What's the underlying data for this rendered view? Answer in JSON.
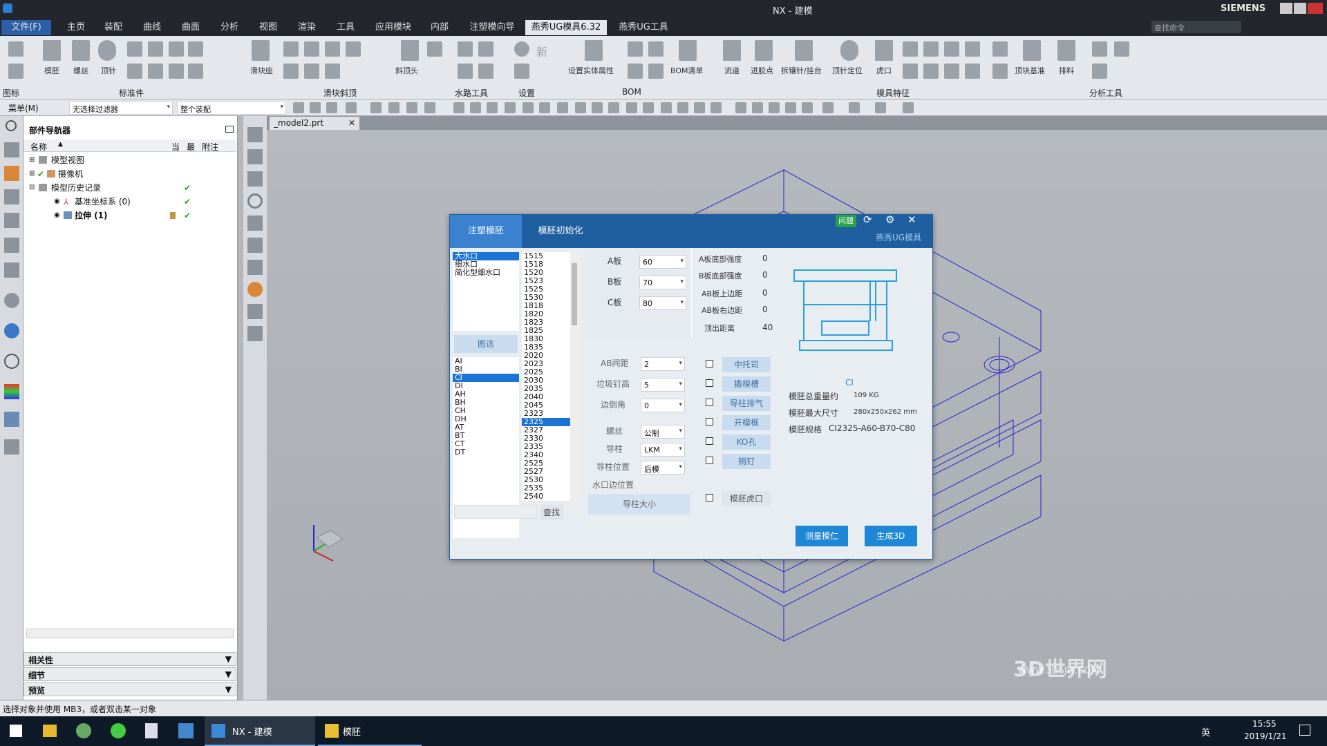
{
  "window": {
    "title": "NX - 建模",
    "brand": "SIEMENS",
    "search_placeholder": "查找命令"
  },
  "ribbon": {
    "tabs": [
      "文件(F)",
      "主页",
      "装配",
      "曲线",
      "曲面",
      "分析",
      "视图",
      "渲染",
      "工具",
      "应用模块",
      "内部",
      "注塑模向导",
      "燕秀UG模具6.32",
      "燕秀UG工具"
    ],
    "buttons": [
      "模胚",
      "螺丝",
      "顶针",
      "滑块座",
      "斜顶头",
      "设置实体属性",
      "BOM清单",
      "流道",
      "进胶点",
      "拆镶针/挂台",
      "顶针定位",
      "虎口",
      "顶块基准",
      "排料"
    ],
    "groups": [
      "图标",
      "标准件",
      "滑块斜顶",
      "水路工具",
      "设置",
      "BOM",
      "模具特征",
      "分析工具"
    ]
  },
  "selbar": {
    "menu": "菜单(M)",
    "filter": "无选择过滤器",
    "scope": "整个装配"
  },
  "nav": {
    "title": "部件导航器",
    "cols": [
      "名称",
      "当",
      "最",
      "附注"
    ],
    "rows": [
      "模型视图",
      "摄像机",
      "模型历史记录",
      "基准坐标系 (0)",
      "拉伸 (1)"
    ],
    "panels": [
      "相关性",
      "细节",
      "预览"
    ]
  },
  "file_tab": "_model2.prt",
  "dialog": {
    "tabs": [
      "注塑模胚",
      "模胚初始化"
    ],
    "question": "问题",
    "brand": "燕秀UG模具",
    "types": [
      "大水口",
      "细水口",
      "简化型细水口"
    ],
    "filter_btn": "图选",
    "series": [
      "AI",
      "BI",
      "CI",
      "DI",
      "AH",
      "BH",
      "CH",
      "DH",
      "AT",
      "BT",
      "CT",
      "DT"
    ],
    "sizes": [
      "1515",
      "1518",
      "1520",
      "1523",
      "1525",
      "1530",
      "1818",
      "1820",
      "1823",
      "1825",
      "1830",
      "1835",
      "2020",
      "2023",
      "2025",
      "2030",
      "2035",
      "2040",
      "2045",
      "2323",
      "2325",
      "2327",
      "2330",
      "2335",
      "2340",
      "2525",
      "2527",
      "2530",
      "2535",
      "2540"
    ],
    "search_btn": "查找",
    "plates": [
      {
        "label": "A板",
        "value": "60"
      },
      {
        "label": "B板",
        "value": "70"
      },
      {
        "label": "C板",
        "value": "80"
      }
    ],
    "strengths": [
      {
        "label": "A板底部强度",
        "value": "0"
      },
      {
        "label": "B板底部强度",
        "value": "0"
      },
      {
        "label": "AB板上边距",
        "value": "0"
      },
      {
        "label": "AB板右边距",
        "value": "0"
      },
      {
        "label": "顶出距离",
        "value": "40"
      }
    ],
    "params": [
      {
        "label": "AB间距",
        "value": "2"
      },
      {
        "label": "垃圾钉高",
        "value": "5"
      },
      {
        "label": "边倒角",
        "value": "0"
      },
      {
        "label": "螺丝",
        "value": "公制"
      },
      {
        "label": "导柱",
        "value": "LKM"
      },
      {
        "label": "导柱位置",
        "value": "后模"
      }
    ],
    "water_label": "水口边位置",
    "guide_btn": "导柱大小",
    "options": [
      "中托司",
      "撬模槽",
      "导柱排气",
      "开模框",
      "KO孔",
      "销钉",
      "模胚虎口"
    ],
    "series_name": "CI",
    "info": [
      {
        "label": "模胚总重量约",
        "value": "109 KG"
      },
      {
        "label": "模胚最大尺寸",
        "value": "280x250x262 mm"
      },
      {
        "label": "模胚规格",
        "value": "CI2325-A60-B70-C80"
      }
    ],
    "measure_btn": "测量模仁",
    "gen_btn": "生成3D"
  },
  "status": "选择对象并使用 MB3，或者双击某一对象",
  "taskbar": {
    "app1": "NX - 建模",
    "app2": "模胚",
    "time": "15:55",
    "date": "2019/1/21",
    "lang": "英"
  },
  "watermark": "3D世界网",
  "watermark_url": "WWW.3DSJW.COM"
}
